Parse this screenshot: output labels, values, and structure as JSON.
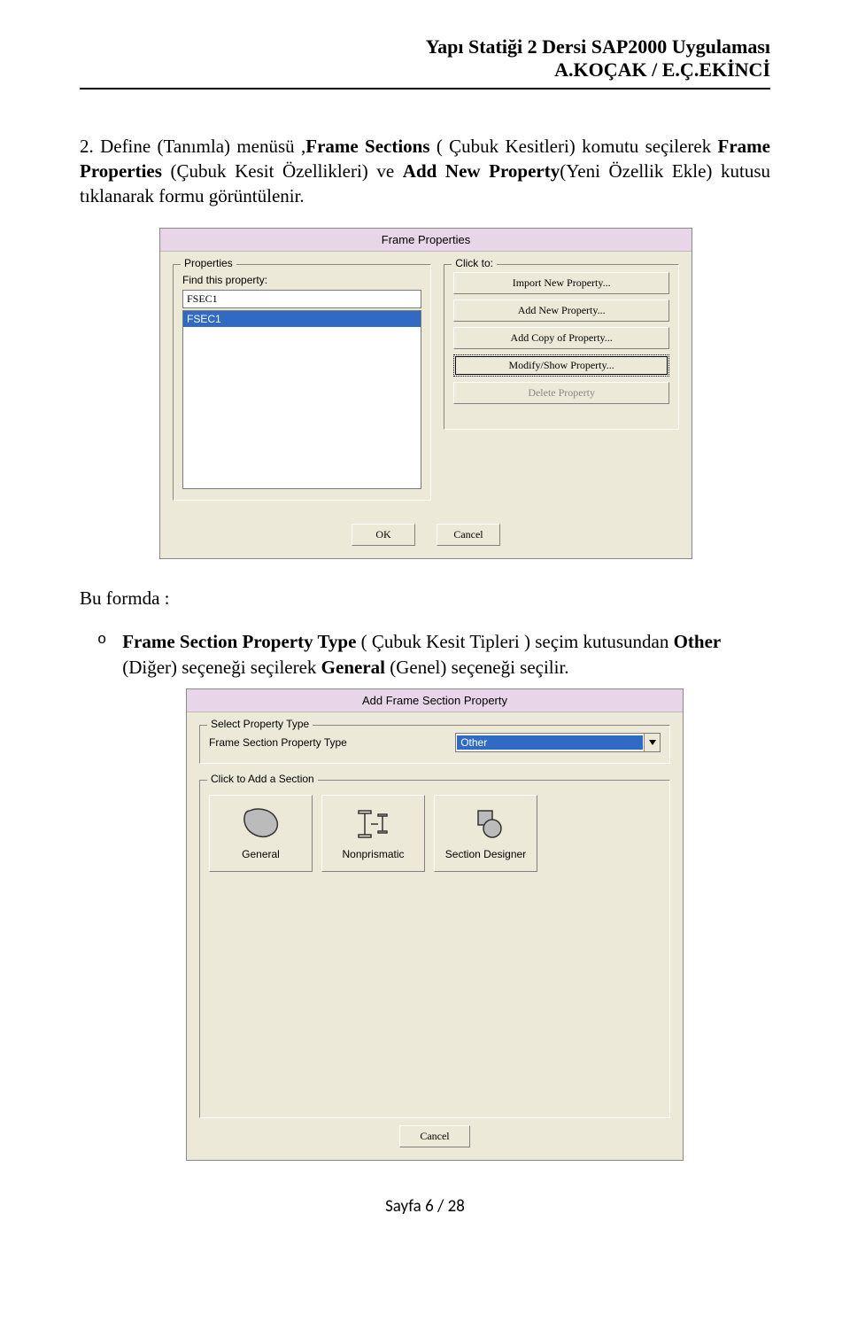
{
  "header": {
    "line1": "Yapı Statiği 2  Dersi SAP2000 Uygulaması",
    "line2": "A.KOÇAK / E.Ç.EKİNCİ"
  },
  "para1": {
    "num": "2.",
    "t1": "Define (Tanımla) menüsü ,",
    "b1": "Frame Sections",
    "t2": " ( Çubuk Kesitleri) komutu seçilerek ",
    "b2": "Frame Properties",
    "t3": " (Çubuk Kesit Özellikleri) ve ",
    "b3": "Add New Property",
    "t4": "(Yeni Özellik Ekle) kutusu tıklanarak formu görüntülenir."
  },
  "dlg1": {
    "title": "Frame Properties",
    "grpProps": "Properties",
    "findLabel": "Find this property:",
    "findValue": "FSEC1",
    "listItems": [
      "FSEC1"
    ],
    "grpClick": "Click to:",
    "btnImport": "Import New Property...",
    "btnAddNew": "Add New Property...",
    "btnAddCopy": "Add Copy of Property...",
    "btnModify": "Modify/Show Property...",
    "btnDelete": "Delete Property",
    "btnOK": "OK",
    "btnCancel": "Cancel"
  },
  "para2a": "Bu formda :",
  "bullet": {
    "marker": "o",
    "b1": "Frame Section Property Type",
    "t1": " ( Çubuk Kesit Tipleri ) seçim kutusundan ",
    "b2": "Other",
    "t2": " (Diğer) seçeneği seçilerek ",
    "b3": "General",
    "t3": " (Genel) seçeneği seçilir."
  },
  "dlg2": {
    "title": "Add Frame Section Property",
    "grpSelect": "Select Property Type",
    "ddLabel": "Frame Section Property Type",
    "ddValue": "Other",
    "grpAdd": "Click to Add a Section",
    "capGeneral": "General",
    "capNonprism": "Nonprismatic",
    "capSectDes": "Section Designer",
    "btnCancel": "Cancel"
  },
  "footer": {
    "text": "Sayfa 6 / 28"
  }
}
